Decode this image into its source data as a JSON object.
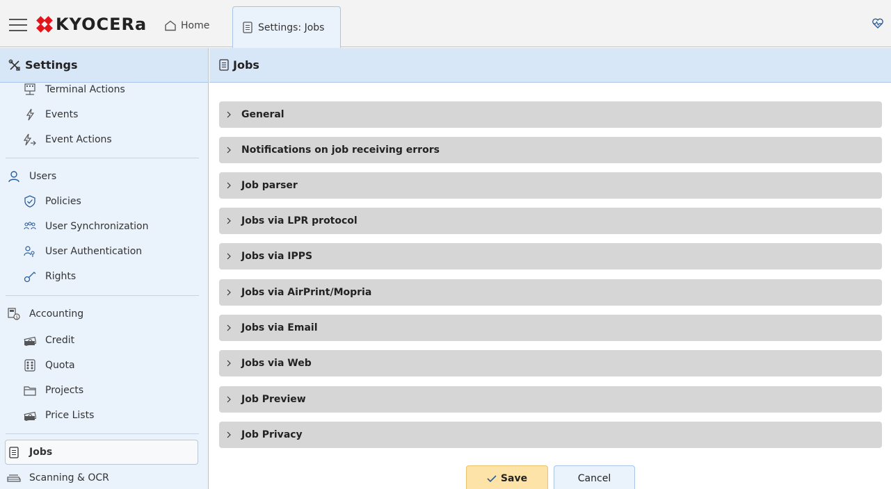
{
  "app": {
    "logo_text": "KYOCERa",
    "tabs": [
      {
        "label": "Home",
        "icon": "home-icon"
      },
      {
        "label": "Settings: Jobs",
        "icon": "document-icon"
      }
    ]
  },
  "left_panel": {
    "title": "Settings",
    "items": [
      {
        "label": "Terminal Actions",
        "icon": "terminal-icon"
      },
      {
        "label": "Events",
        "icon": "lightning-icon"
      },
      {
        "label": "Event Actions",
        "icon": "lightning-arrow-icon"
      },
      {
        "label": "Users",
        "icon": "user-icon"
      },
      {
        "label": "Policies",
        "icon": "shield-check-icon"
      },
      {
        "label": "User Synchronization",
        "icon": "users-sync-icon"
      },
      {
        "label": "User Authentication",
        "icon": "user-key-icon"
      },
      {
        "label": "Rights",
        "icon": "key-icon"
      },
      {
        "label": "Accounting",
        "icon": "accounting-icon"
      },
      {
        "label": "Credit",
        "icon": "money-icon"
      },
      {
        "label": "Quota",
        "icon": "abacus-icon"
      },
      {
        "label": "Projects",
        "icon": "folder-icon"
      },
      {
        "label": "Price Lists",
        "icon": "money-icon"
      },
      {
        "label": "Jobs",
        "icon": "document-icon"
      },
      {
        "label": "Scanning & OCR",
        "icon": "scanner-icon"
      }
    ]
  },
  "main": {
    "title": "Jobs",
    "sections": [
      "General",
      "Notifications on job receiving errors",
      "Job parser",
      "Jobs via LPR protocol",
      "Jobs via IPPS",
      "Jobs via AirPrint/Mopria",
      "Jobs via Email",
      "Jobs via Web",
      "Job Preview",
      "Job Privacy"
    ]
  },
  "buttons": {
    "save": "Save",
    "cancel": "Cancel"
  },
  "colors": {
    "header_bg": "#d8e7f8",
    "sidebar_bg": "#eaf2fc",
    "section_bg": "#d6d6d6",
    "save_bg": "#fde3a7",
    "logo_red": "#e3151a"
  }
}
